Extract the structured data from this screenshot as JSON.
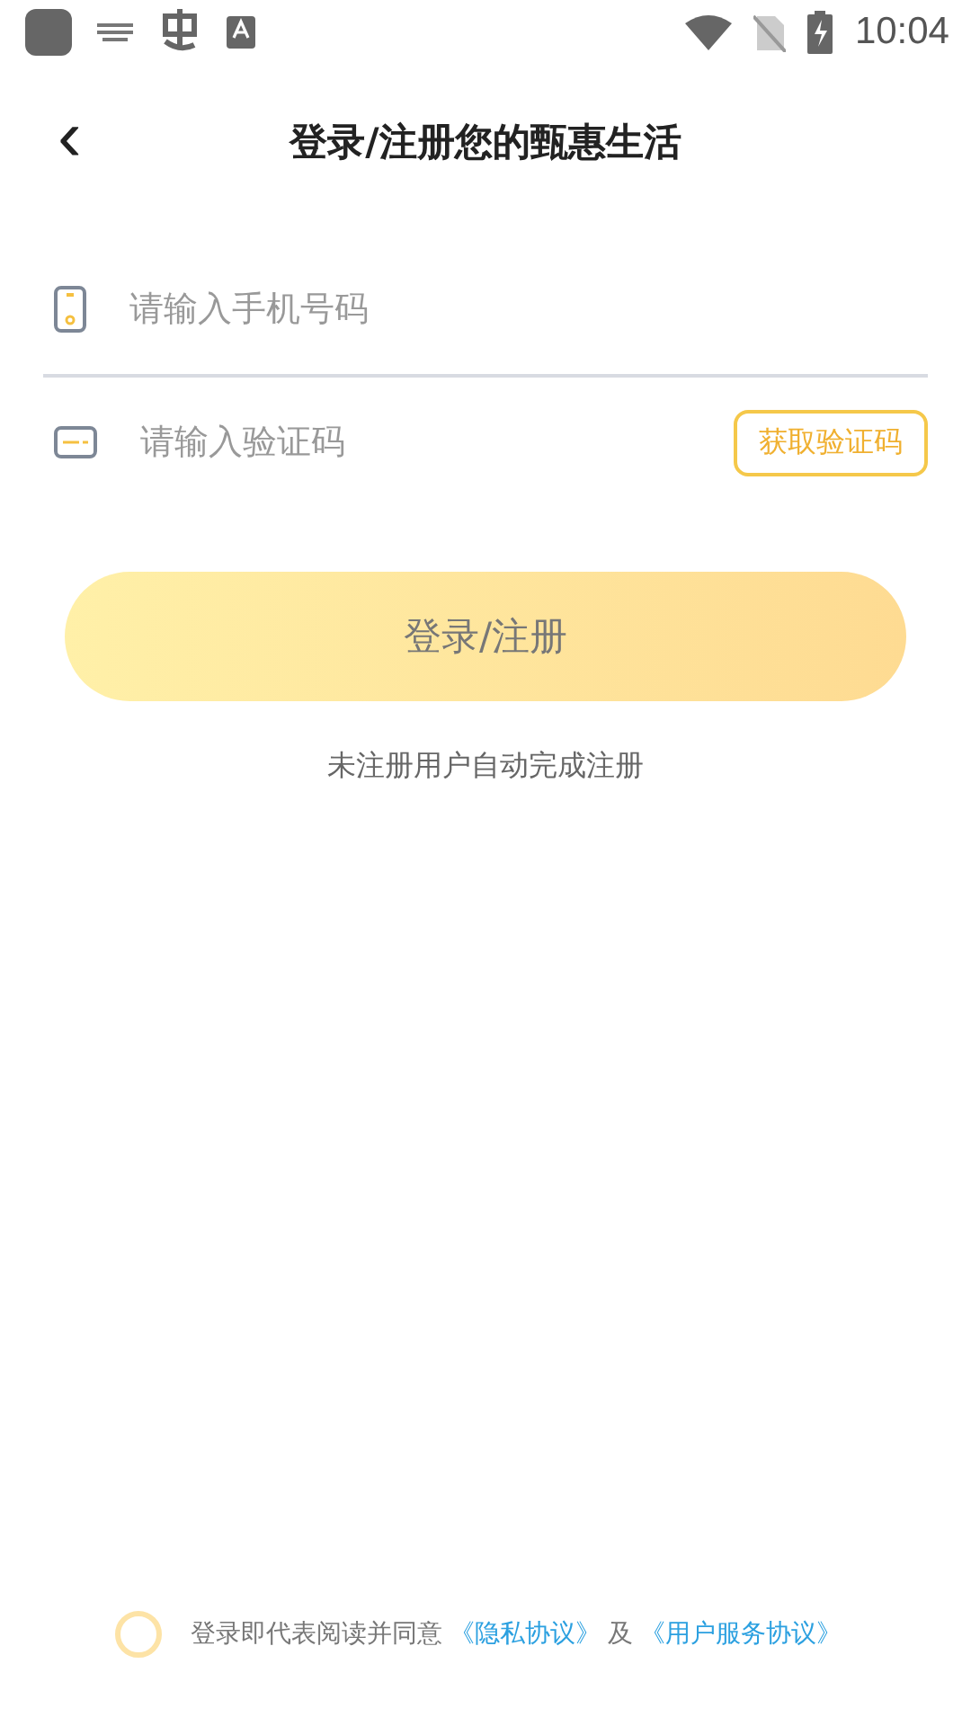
{
  "status_bar": {
    "time": "10:04"
  },
  "header": {
    "back": "‹",
    "title": "登录/注册您的甄惠生活"
  },
  "phone_field": {
    "placeholder": "请输入手机号码"
  },
  "code_field": {
    "placeholder": "请输入验证码",
    "button": "获取验证码"
  },
  "login_button": {
    "label": "登录/注册",
    "disabled": true
  },
  "hint": "未注册用户自动完成注册",
  "agreement": {
    "checked": false,
    "text": "登录即代表阅读并同意",
    "links": [
      "《隐私协议》",
      "《用户服务协议》"
    ],
    "joiner": "及"
  }
}
